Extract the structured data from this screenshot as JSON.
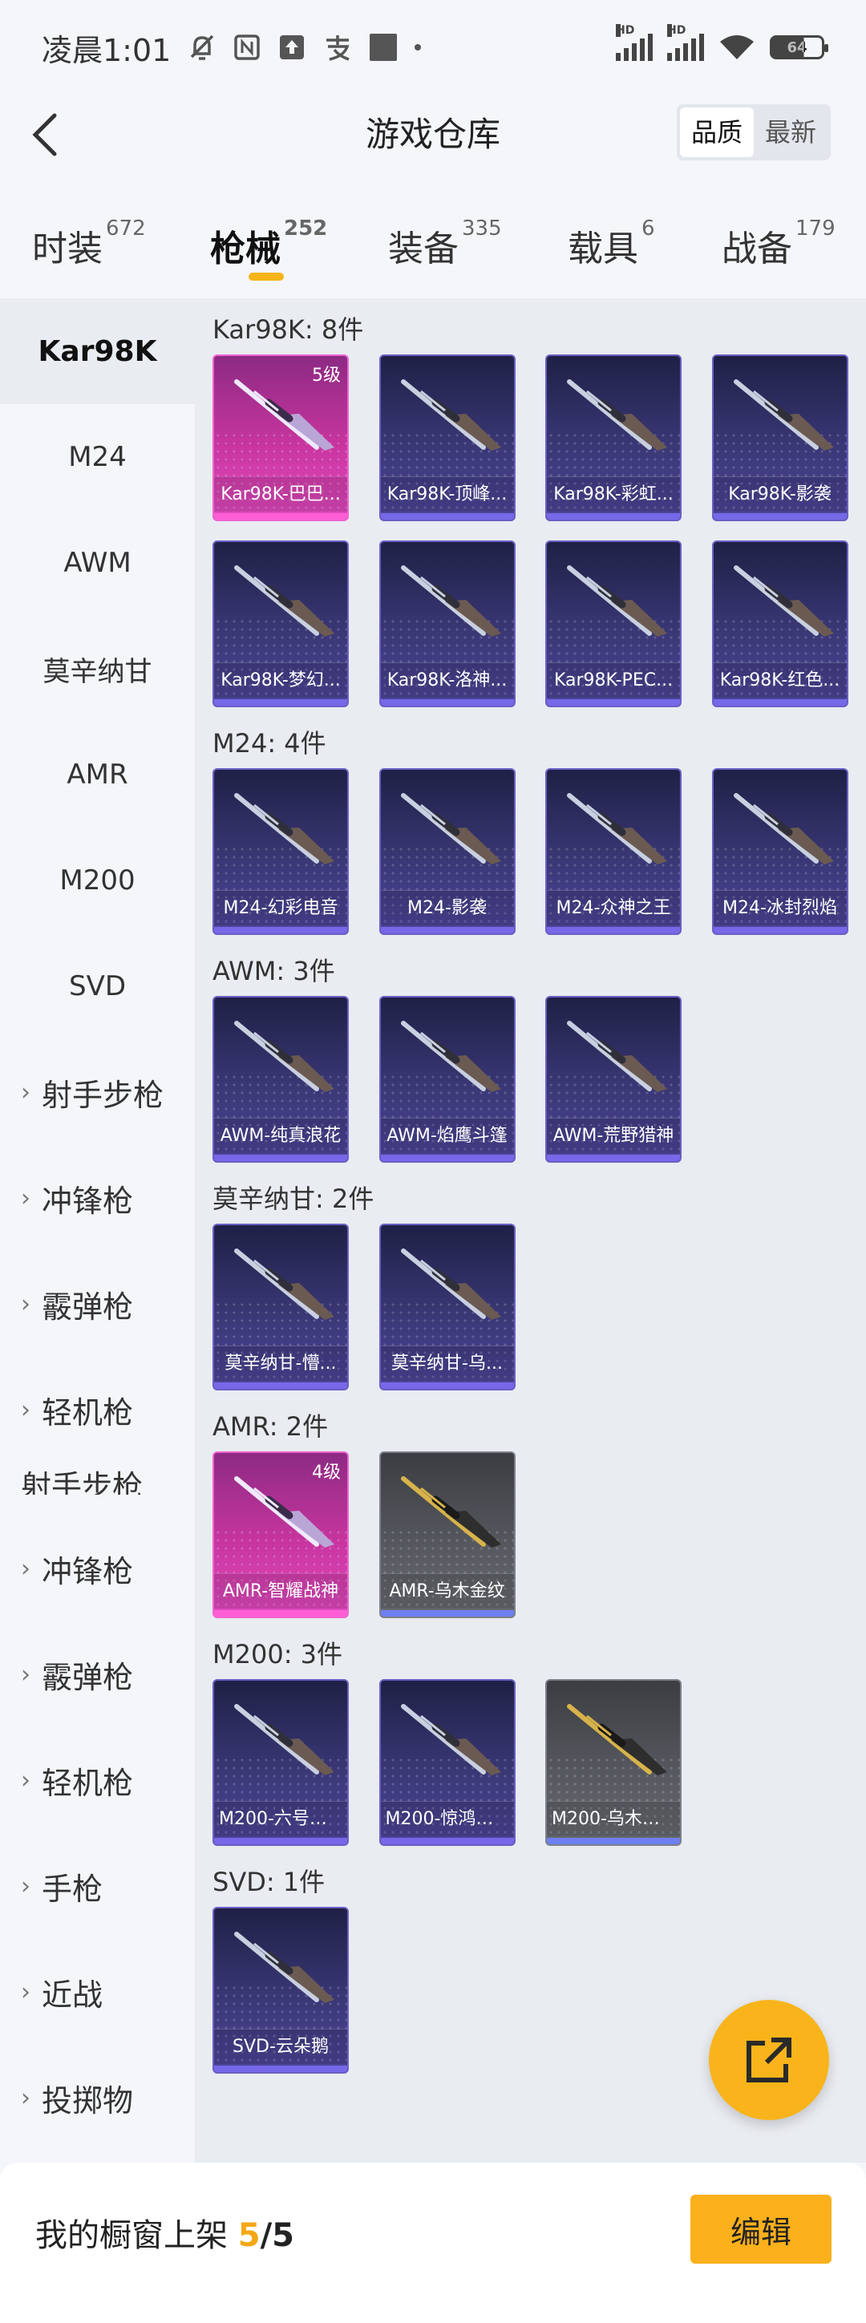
{
  "status_bar": {
    "time": "凌晨1:01",
    "battery": "64",
    "icons": [
      "mute-bell-icon",
      "nfc-icon",
      "upload-icon",
      "alipay-icon",
      "square-icon",
      "dot-icon",
      "signal-hd-icon",
      "signal-hd-icon",
      "wifi-icon",
      "battery-icon"
    ]
  },
  "header": {
    "title": "游戏仓库",
    "sort_options": [
      "品质",
      "最新"
    ],
    "active_sort": "品质"
  },
  "tabs": [
    {
      "label": "时装",
      "count": "672"
    },
    {
      "label": "枪械",
      "count": "252",
      "active": true
    },
    {
      "label": "装备",
      "count": "335"
    },
    {
      "label": "载具",
      "count": "6"
    },
    {
      "label": "战备",
      "count": "179"
    }
  ],
  "sidebar": {
    "items": [
      "Kar98K",
      "M24",
      "AWM",
      "莫辛纳甘",
      "AMR",
      "M200",
      "SVD",
      "射手步枪",
      "冲锋枪",
      "霰弹枪",
      "轻机枪",
      "射手步枪",
      "冲锋枪",
      "霰弹枪",
      "轻机枪",
      "手枪",
      "近战",
      "投掷物"
    ]
  },
  "sections": [
    {
      "title": "Kar98K: 8件",
      "items": [
        {
          "name": "Kar98K-巴巴...",
          "level": "5级",
          "rarity": "pink"
        },
        {
          "name": "Kar98K-顶峰...",
          "rarity": "purple"
        },
        {
          "name": "Kar98K-彩虹...",
          "rarity": "purple"
        },
        {
          "name": "Kar98K-影袭",
          "rarity": "purple"
        },
        {
          "name": "Kar98K-梦幻...",
          "rarity": "purple"
        },
        {
          "name": "Kar98K-洛神...",
          "rarity": "purple"
        },
        {
          "name": "Kar98K-PEC...",
          "rarity": "purple"
        },
        {
          "name": "Kar98K-红色...",
          "rarity": "purple"
        }
      ]
    },
    {
      "title": "M24: 4件",
      "items": [
        {
          "name": "M24-幻彩电音",
          "rarity": "purple"
        },
        {
          "name": "M24-影袭",
          "rarity": "purple"
        },
        {
          "name": "M24-众神之王",
          "rarity": "purple"
        },
        {
          "name": "M24-冰封烈焰",
          "rarity": "purple"
        }
      ]
    },
    {
      "title": "AWM: 3件",
      "items": [
        {
          "name": "AWM-纯真浪花",
          "rarity": "purple"
        },
        {
          "name": "AWM-焰鹰斗篷",
          "rarity": "purple"
        },
        {
          "name": "AWM-荒野猎神",
          "rarity": "purple"
        }
      ]
    },
    {
      "title": "莫辛纳甘: 2件",
      "items": [
        {
          "name": "莫辛纳甘-懵...",
          "rarity": "purple"
        },
        {
          "name": "莫辛纳甘-乌...",
          "rarity": "purple"
        }
      ]
    },
    {
      "title": "AMR: 2件",
      "items": [
        {
          "name": "AMR-智耀战神",
          "level": "4级",
          "rarity": "pink"
        },
        {
          "name": "AMR-乌木金纹",
          "rarity": "grey"
        }
      ]
    },
    {
      "title": "M200: 3件",
      "items": [
        {
          "name": "M200-六号稻...",
          "rarity": "purple"
        },
        {
          "name": "M200-惊鸿侠...",
          "rarity": "purple"
        },
        {
          "name": "M200-乌木金...",
          "rarity": "grey"
        }
      ]
    },
    {
      "title": "SVD: 1件",
      "items": [
        {
          "name": "SVD-云朵鹅",
          "rarity": "purple"
        }
      ]
    }
  ],
  "bottom_bar": {
    "label": "我的橱窗上架",
    "count": "5",
    "total": "/5",
    "edit_label": "编辑"
  },
  "colors": {
    "accent": "#f5b41a",
    "card_purple": "#3a3775",
    "card_pink": "#c8359f",
    "card_grey": "#575a60"
  }
}
